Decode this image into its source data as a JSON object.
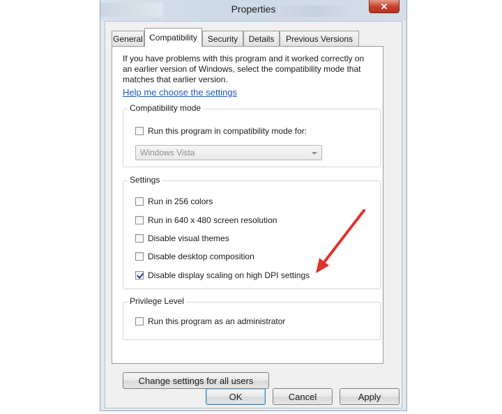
{
  "window": {
    "title": "Properties",
    "close_symbol": "✕"
  },
  "tabs": [
    {
      "label": "General",
      "active": false
    },
    {
      "label": "Compatibility",
      "active": true
    },
    {
      "label": "Security",
      "active": false
    },
    {
      "label": "Details",
      "active": false
    },
    {
      "label": "Previous Versions",
      "active": false
    }
  ],
  "compatibility": {
    "intro_line_1": "If you have problems with this program and it worked correctly on",
    "intro_line_2": "an earlier version of Windows, select the compatibility mode that",
    "intro_line_3": "matches that earlier version.",
    "help_link": "Help me choose the settings",
    "compat_mode": {
      "legend": "Compatibility mode",
      "checkbox_label": "Run this program in compatibility mode for:",
      "checked": false,
      "dropdown_value": "Windows Vista"
    },
    "settings": {
      "legend": "Settings",
      "items": [
        {
          "label": "Run in 256 colors",
          "checked": false
        },
        {
          "label": "Run in 640 x 480 screen resolution",
          "checked": false
        },
        {
          "label": "Disable visual themes",
          "checked": false
        },
        {
          "label": "Disable desktop composition",
          "checked": false
        },
        {
          "label": "Disable display scaling on high DPI settings",
          "checked": true
        }
      ]
    },
    "privilege": {
      "legend": "Privilege Level",
      "checkbox_label": "Run this program as an administrator",
      "checked": false
    },
    "change_all_users_button": "Change settings for all users"
  },
  "footer_buttons": {
    "ok": "OK",
    "cancel": "Cancel",
    "apply": "Apply"
  },
  "colors": {
    "link": "#1c59b8",
    "annotation_arrow": "#e0332b",
    "close_button": "#c7402a"
  }
}
